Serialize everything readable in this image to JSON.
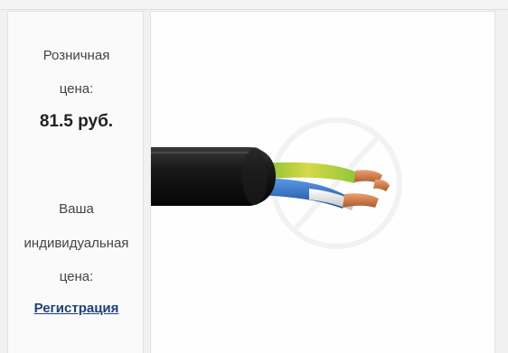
{
  "price_block": {
    "retail_label_line1": "Розничная",
    "retail_label_line2": "цена:",
    "retail_price": "81.5 руб.",
    "individual_label_line1": "Ваша",
    "individual_label_line2": "индивидуальная",
    "individual_label_line3": "цена:",
    "register_link": "Регистрация"
  },
  "product_image": {
    "icon": "cable-product-image",
    "colors": {
      "sheath": "#151515",
      "core_green_yellow": "#9bcc3a",
      "core_blue": "#2d6ec7",
      "core_white": "#e8e8e8",
      "copper": "#c8743e"
    }
  }
}
